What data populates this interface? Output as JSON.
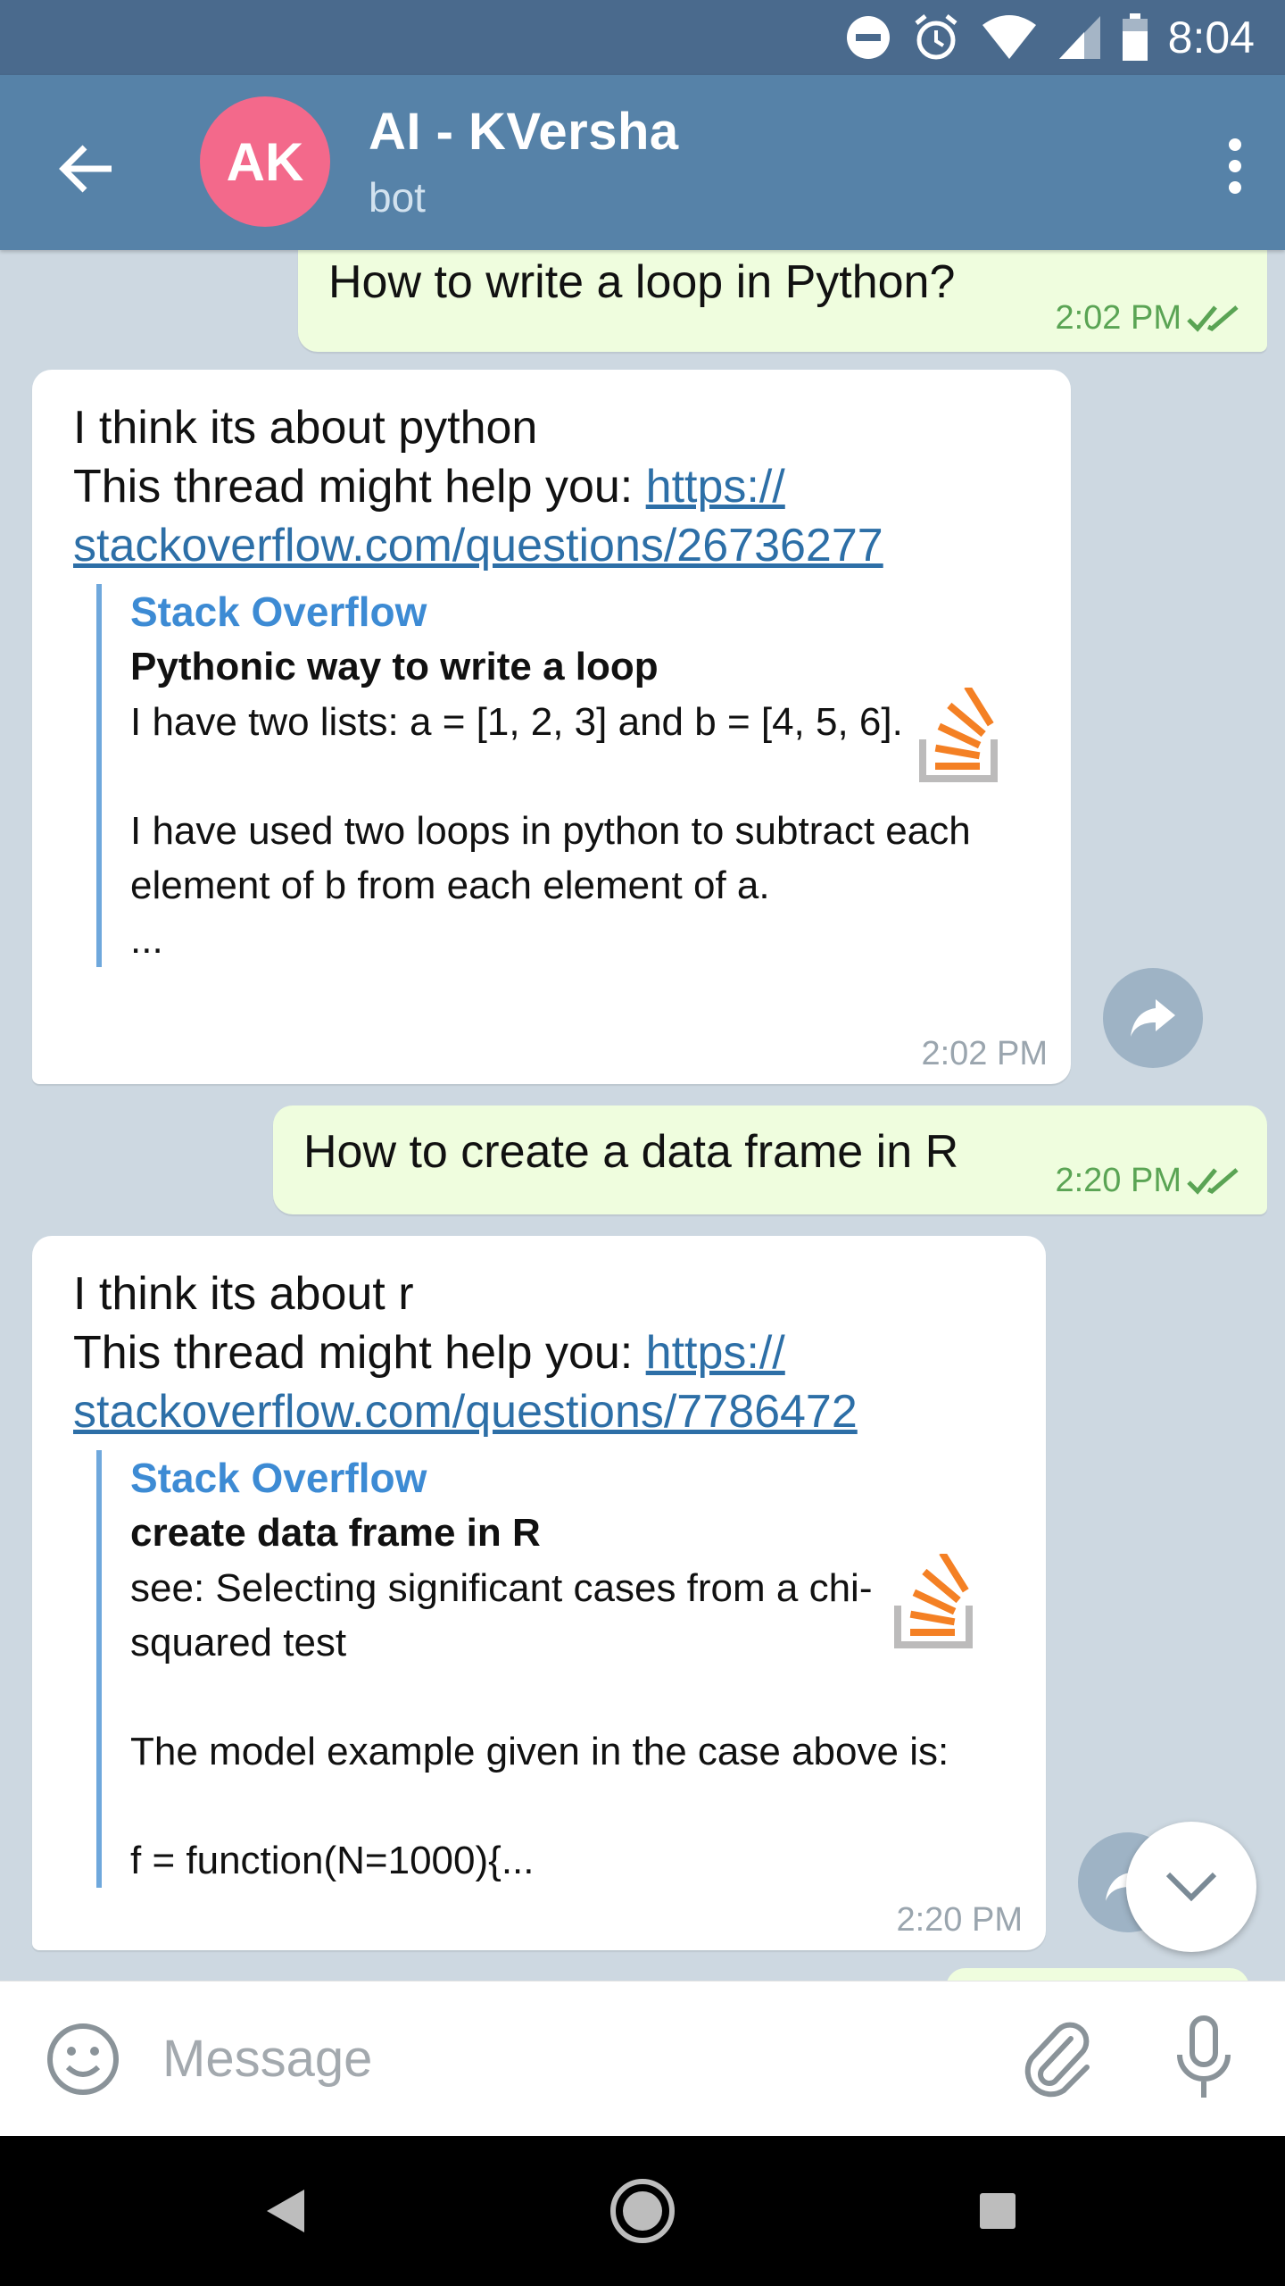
{
  "status_bar": {
    "time": "8:04"
  },
  "header": {
    "avatar_initials": "AK",
    "title": "AI - KVersha",
    "subtitle": "bot"
  },
  "messages": [
    {
      "direction": "outgoing",
      "text": "How to write a loop in Python?",
      "time": "2:02 PM"
    },
    {
      "direction": "incoming",
      "line1": "I think its about python",
      "line2_prefix": "This thread might help you: ",
      "link_part1": "https://",
      "link_part2": "stackoverflow.com/questions/26736277",
      "preview": {
        "site": "Stack Overflow",
        "title": "Pythonic way to write a loop",
        "desc1": "I have two lists: a = [1, 2, 3] and b = [4, 5, 6].",
        "desc2": "I have used two loops in python to subtract each element of b from each element of a.\n...",
        "thumb_icon": "stackoverflow-logo-icon"
      },
      "time": "2:02 PM"
    },
    {
      "direction": "outgoing",
      "text": "How to create a data frame in R",
      "time": "2:20 PM"
    },
    {
      "direction": "incoming",
      "line1": "I think its about r",
      "line2_prefix": "This thread might help you: ",
      "link_part1": "https://",
      "link_part2": "stackoverflow.com/questions/7786472",
      "preview": {
        "site": "Stack Overflow",
        "title": "create data frame in R",
        "desc1": "see: Selecting significant cases from a chi-squared test",
        "desc2": "The model example given in the case above is:\n\n  f = function(N=1000){...",
        "thumb_icon": "stackoverflow-logo-icon"
      },
      "time": "2:20 PM"
    }
  ],
  "input": {
    "placeholder": "Message"
  },
  "colors": {
    "header": "#5682a8",
    "status_bar": "#4a6a8d",
    "avatar": "#f3698b",
    "outgoing_bubble": "#effdde",
    "link": "#2d6fa7",
    "preview_site": "#3d8bd4"
  }
}
